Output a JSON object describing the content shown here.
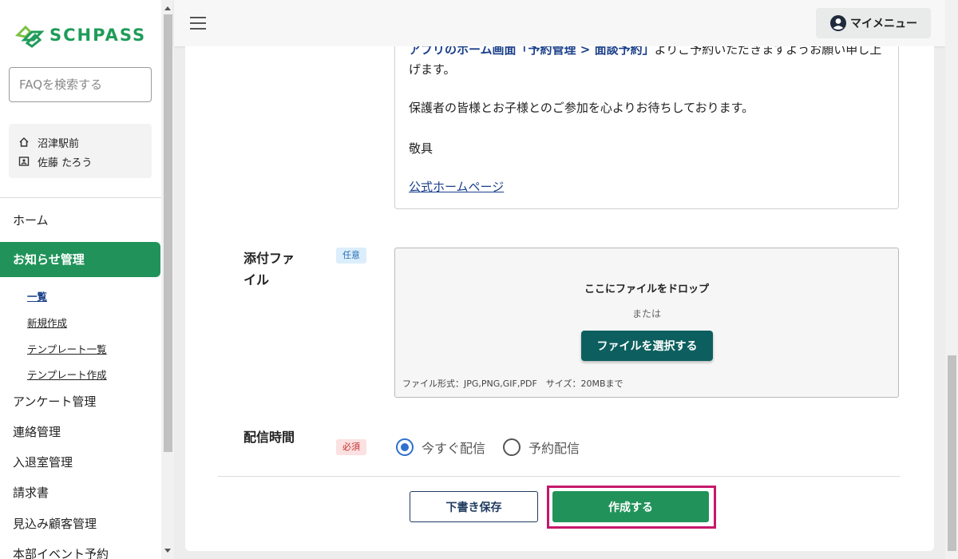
{
  "sidebar": {
    "logo_text": "SCHPASS",
    "search_placeholder": "FAQを検索する",
    "school_name": "沼津駅前",
    "user_name": "佐藤 たろう",
    "nav": {
      "home": "ホーム",
      "notice_manage": "お知らせ管理",
      "notice_sub": [
        "一覧",
        "新規作成",
        "テンプレート一覧",
        "テンプレート作成"
      ],
      "survey": "アンケート管理",
      "contact": "連絡管理",
      "attendance": "入退室管理",
      "invoice": "請求書",
      "prospects": "見込み顧客管理",
      "hq_events": "本部イベント予約"
    }
  },
  "header": {
    "my_menu": "マイメニュー"
  },
  "message": {
    "line1_prefix": "アプリのホーム画面「予約管理 > 面談予約」",
    "line1_suffix": "よりご予約いただきますようお願い申し上",
    "line2": "げます。",
    "line3": "保護者の皆様とお子様とのご参加を心よりお待ちしております。",
    "line4": "敬具",
    "homepage_link": "公式ホームページ"
  },
  "attachment": {
    "label": "添付ファイル",
    "badge": "任意",
    "drop_title": "ここにファイルをドロップ",
    "or_text": "または",
    "select_button": "ファイルを選択する",
    "note": "ファイル形式：JPG,PNG,GIF,PDF　サイズ：20MBまで"
  },
  "delivery": {
    "label": "配信時間",
    "badge": "必須",
    "options": [
      "今すぐ配信",
      "予約配信"
    ],
    "selected": "今すぐ配信"
  },
  "actions": {
    "draft": "下書き保存",
    "create": "作成する"
  },
  "colors": {
    "brand_green": "#21935a",
    "dark_teal": "#0d5f5f",
    "link_blue": "#1a3f8a",
    "highlight": "#c6176b"
  }
}
